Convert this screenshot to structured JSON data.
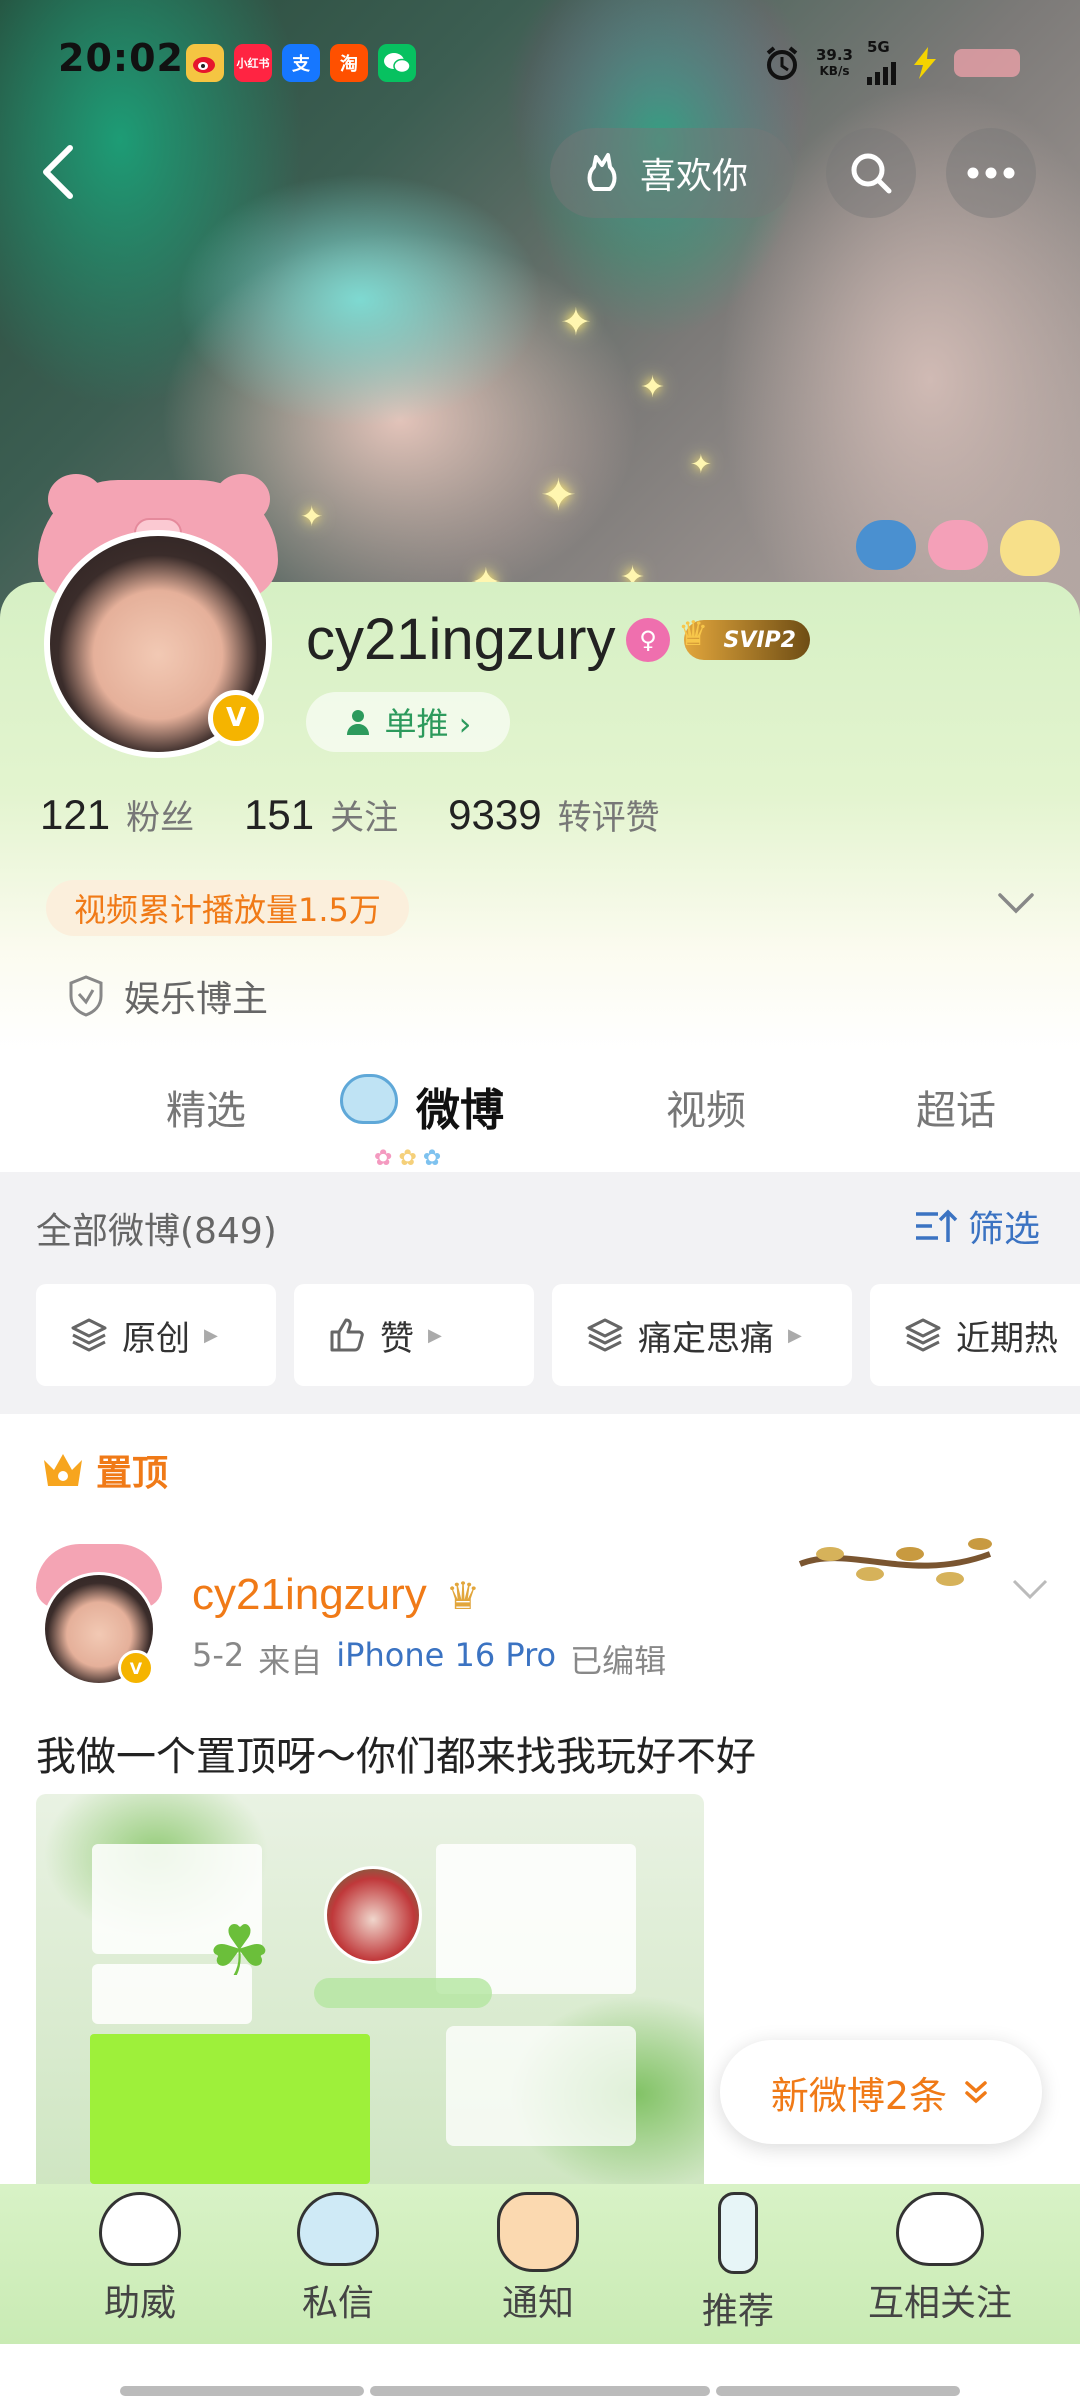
{
  "status_bar": {
    "time": "20:02",
    "app_icons": [
      {
        "name": "weibo-icon",
        "label": "",
        "color": "#f5c542"
      },
      {
        "name": "xiaohongshu-icon",
        "label": "小红书",
        "color": "#ff2442"
      },
      {
        "name": "alipay-icon",
        "label": "支",
        "color": "#1677ff"
      },
      {
        "name": "taobao-icon",
        "label": "淘",
        "color": "#ff5000"
      },
      {
        "name": "wechat-icon",
        "label": "",
        "color": "#07c160"
      }
    ],
    "net_speed": "39.3",
    "net_unit": "KB/s",
    "network": "5G"
  },
  "header": {
    "back_icon": "chevron-left-icon",
    "like_label": "喜欢你",
    "search_icon": "search-icon",
    "more_icon": "more-dots-icon"
  },
  "profile": {
    "username": "cy21ingzury",
    "gender_icon": "female-icon",
    "svip_label": "SVIP2",
    "verified_badge": "V",
    "tui_label": "单推 ›",
    "stats": [
      {
        "number": "121",
        "label": "粉丝"
      },
      {
        "number": "151",
        "label": "关注"
      },
      {
        "number": "9339",
        "label": "转评赞"
      }
    ],
    "play_count": "视频累计播放量1.5万",
    "blogger_type": "娱乐博主"
  },
  "tabs": [
    {
      "label": "精选",
      "active": false
    },
    {
      "label": "微博",
      "active": true
    },
    {
      "label": "视频",
      "active": false
    },
    {
      "label": "超话",
      "active": false
    }
  ],
  "filter": {
    "all_label": "全部微博(849)",
    "filter_label": "筛选",
    "chips": [
      {
        "label": "原创",
        "icon": "layers-icon"
      },
      {
        "label": "赞",
        "icon": "thumbs-up-icon"
      },
      {
        "label": "痛定思痛",
        "icon": "layers-icon"
      },
      {
        "label": "近期热",
        "icon": "layers-icon"
      }
    ]
  },
  "post": {
    "pinned_label": "置顶",
    "author": "cy21ingzury",
    "date": "5-2",
    "from": "来自",
    "device": "iPhone 16 Pro",
    "edited": "已编辑",
    "text": "我做一个置顶呀～你们都来找我玩好不好"
  },
  "new_posts": "新微博2条",
  "bottom_nav": [
    {
      "label": "助威",
      "icon": "bear-mascot-icon"
    },
    {
      "label": "私信",
      "icon": "cat-mascot-icon"
    },
    {
      "label": "通知",
      "icon": "bunny-mascot-icon"
    },
    {
      "label": "推荐",
      "icon": "flower-vase-icon"
    },
    {
      "label": "互相关注",
      "icon": "mouse-mascot-icon"
    }
  ],
  "colors": {
    "accent_orange": "#f07a17",
    "link_blue": "#3b73c2",
    "profile_green": "#d6f0c4"
  }
}
